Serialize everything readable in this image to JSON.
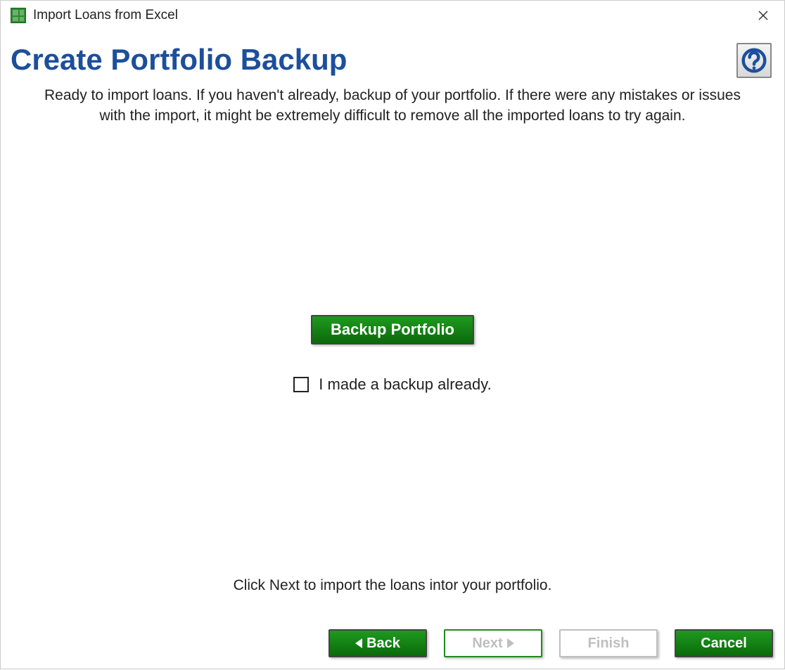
{
  "window": {
    "title": "Import Loans from Excel"
  },
  "page": {
    "heading": "Create Portfolio Backup",
    "description": "Ready to import loans. If you haven't already, backup of your portfolio. If there were any mistakes or issues with the import, it might be extremely difficult to remove all the imported loans to try again.",
    "backup_button": "Backup Portfolio",
    "checkbox_label": "I made a backup already.",
    "hint": "Click Next to import the loans intor your portfolio."
  },
  "buttons": {
    "back": "Back",
    "next": "Next",
    "finish": "Finish",
    "cancel": "Cancel"
  }
}
